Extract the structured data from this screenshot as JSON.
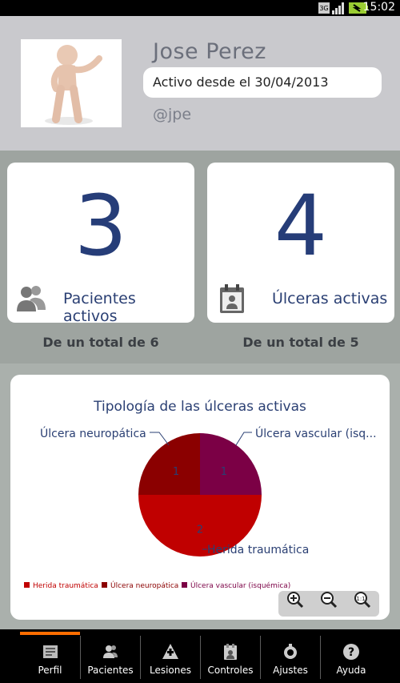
{
  "status_bar": {
    "time": "15:02",
    "icons": [
      "network-3g-icon",
      "signal-icon",
      "battery-icon"
    ]
  },
  "profile": {
    "name": "Jose Perez",
    "since": "Activo desde el 30/04/2013",
    "handle": "@jpe",
    "avatar": "person-figure-avatar"
  },
  "stats": {
    "patients": {
      "count": "3",
      "label": "Pacientes activos",
      "total": "De un total de 6",
      "icon": "users-icon"
    },
    "ulcers": {
      "count": "4",
      "label": "Úlceras activas",
      "total": "De un total de 5",
      "icon": "calendar-person-icon"
    }
  },
  "chart_data": {
    "type": "pie",
    "title": "Tipología de las úlceras activas",
    "slices": [
      {
        "name": "Herida traumática",
        "value": 2,
        "color": "#c00000"
      },
      {
        "name": "Úlcera neuropática",
        "value": 1,
        "color": "#8b0000"
      },
      {
        "name": "Úlcera vascular (isquémica)",
        "value": 1,
        "color": "#7b0045"
      }
    ],
    "outside_labels": [
      "Úlcera neuropática",
      "Úlcera vascular (isq...",
      "Herida traumática"
    ],
    "legend": [
      "Herida traumática",
      "Úlcera neuropática",
      "Úlcera vascular (isquémica)"
    ],
    "legend_placement": "bottom-left"
  },
  "zoom": {
    "icons": [
      "zoom-in-icon",
      "zoom-out-icon",
      "zoom-reset-icon"
    ]
  },
  "nav": {
    "active": "Perfil",
    "items": [
      {
        "label": "Perfil",
        "icon": "profile-icon"
      },
      {
        "label": "Pacientes",
        "icon": "patients-icon"
      },
      {
        "label": "Lesiones",
        "icon": "lesions-icon"
      },
      {
        "label": "Controles",
        "icon": "controls-icon"
      },
      {
        "label": "Ajustes",
        "icon": "settings-icon"
      },
      {
        "label": "Ayuda",
        "icon": "help-icon"
      }
    ]
  },
  "colors": {
    "accent": "#ff6d00",
    "number": "#263d78",
    "text": "#2a3f73"
  }
}
